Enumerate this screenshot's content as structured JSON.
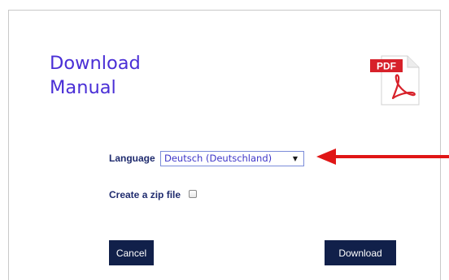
{
  "dialog": {
    "title_line1": "Download",
    "title_line2": "Manual",
    "pdf_icon": {
      "badge": "PDF",
      "icon": "pdf-file-icon"
    },
    "language": {
      "label": "Language",
      "selected": "Deutsch (Deutschland)",
      "caret": "▼"
    },
    "zip": {
      "label": "Create a zip file",
      "checked": false
    },
    "buttons": {
      "cancel": "Cancel",
      "download": "Download"
    }
  },
  "colors": {
    "title": "#4a2fd6",
    "button_bg": "#11204a",
    "arrow": "#e01616",
    "pdf_red": "#d7212a"
  }
}
